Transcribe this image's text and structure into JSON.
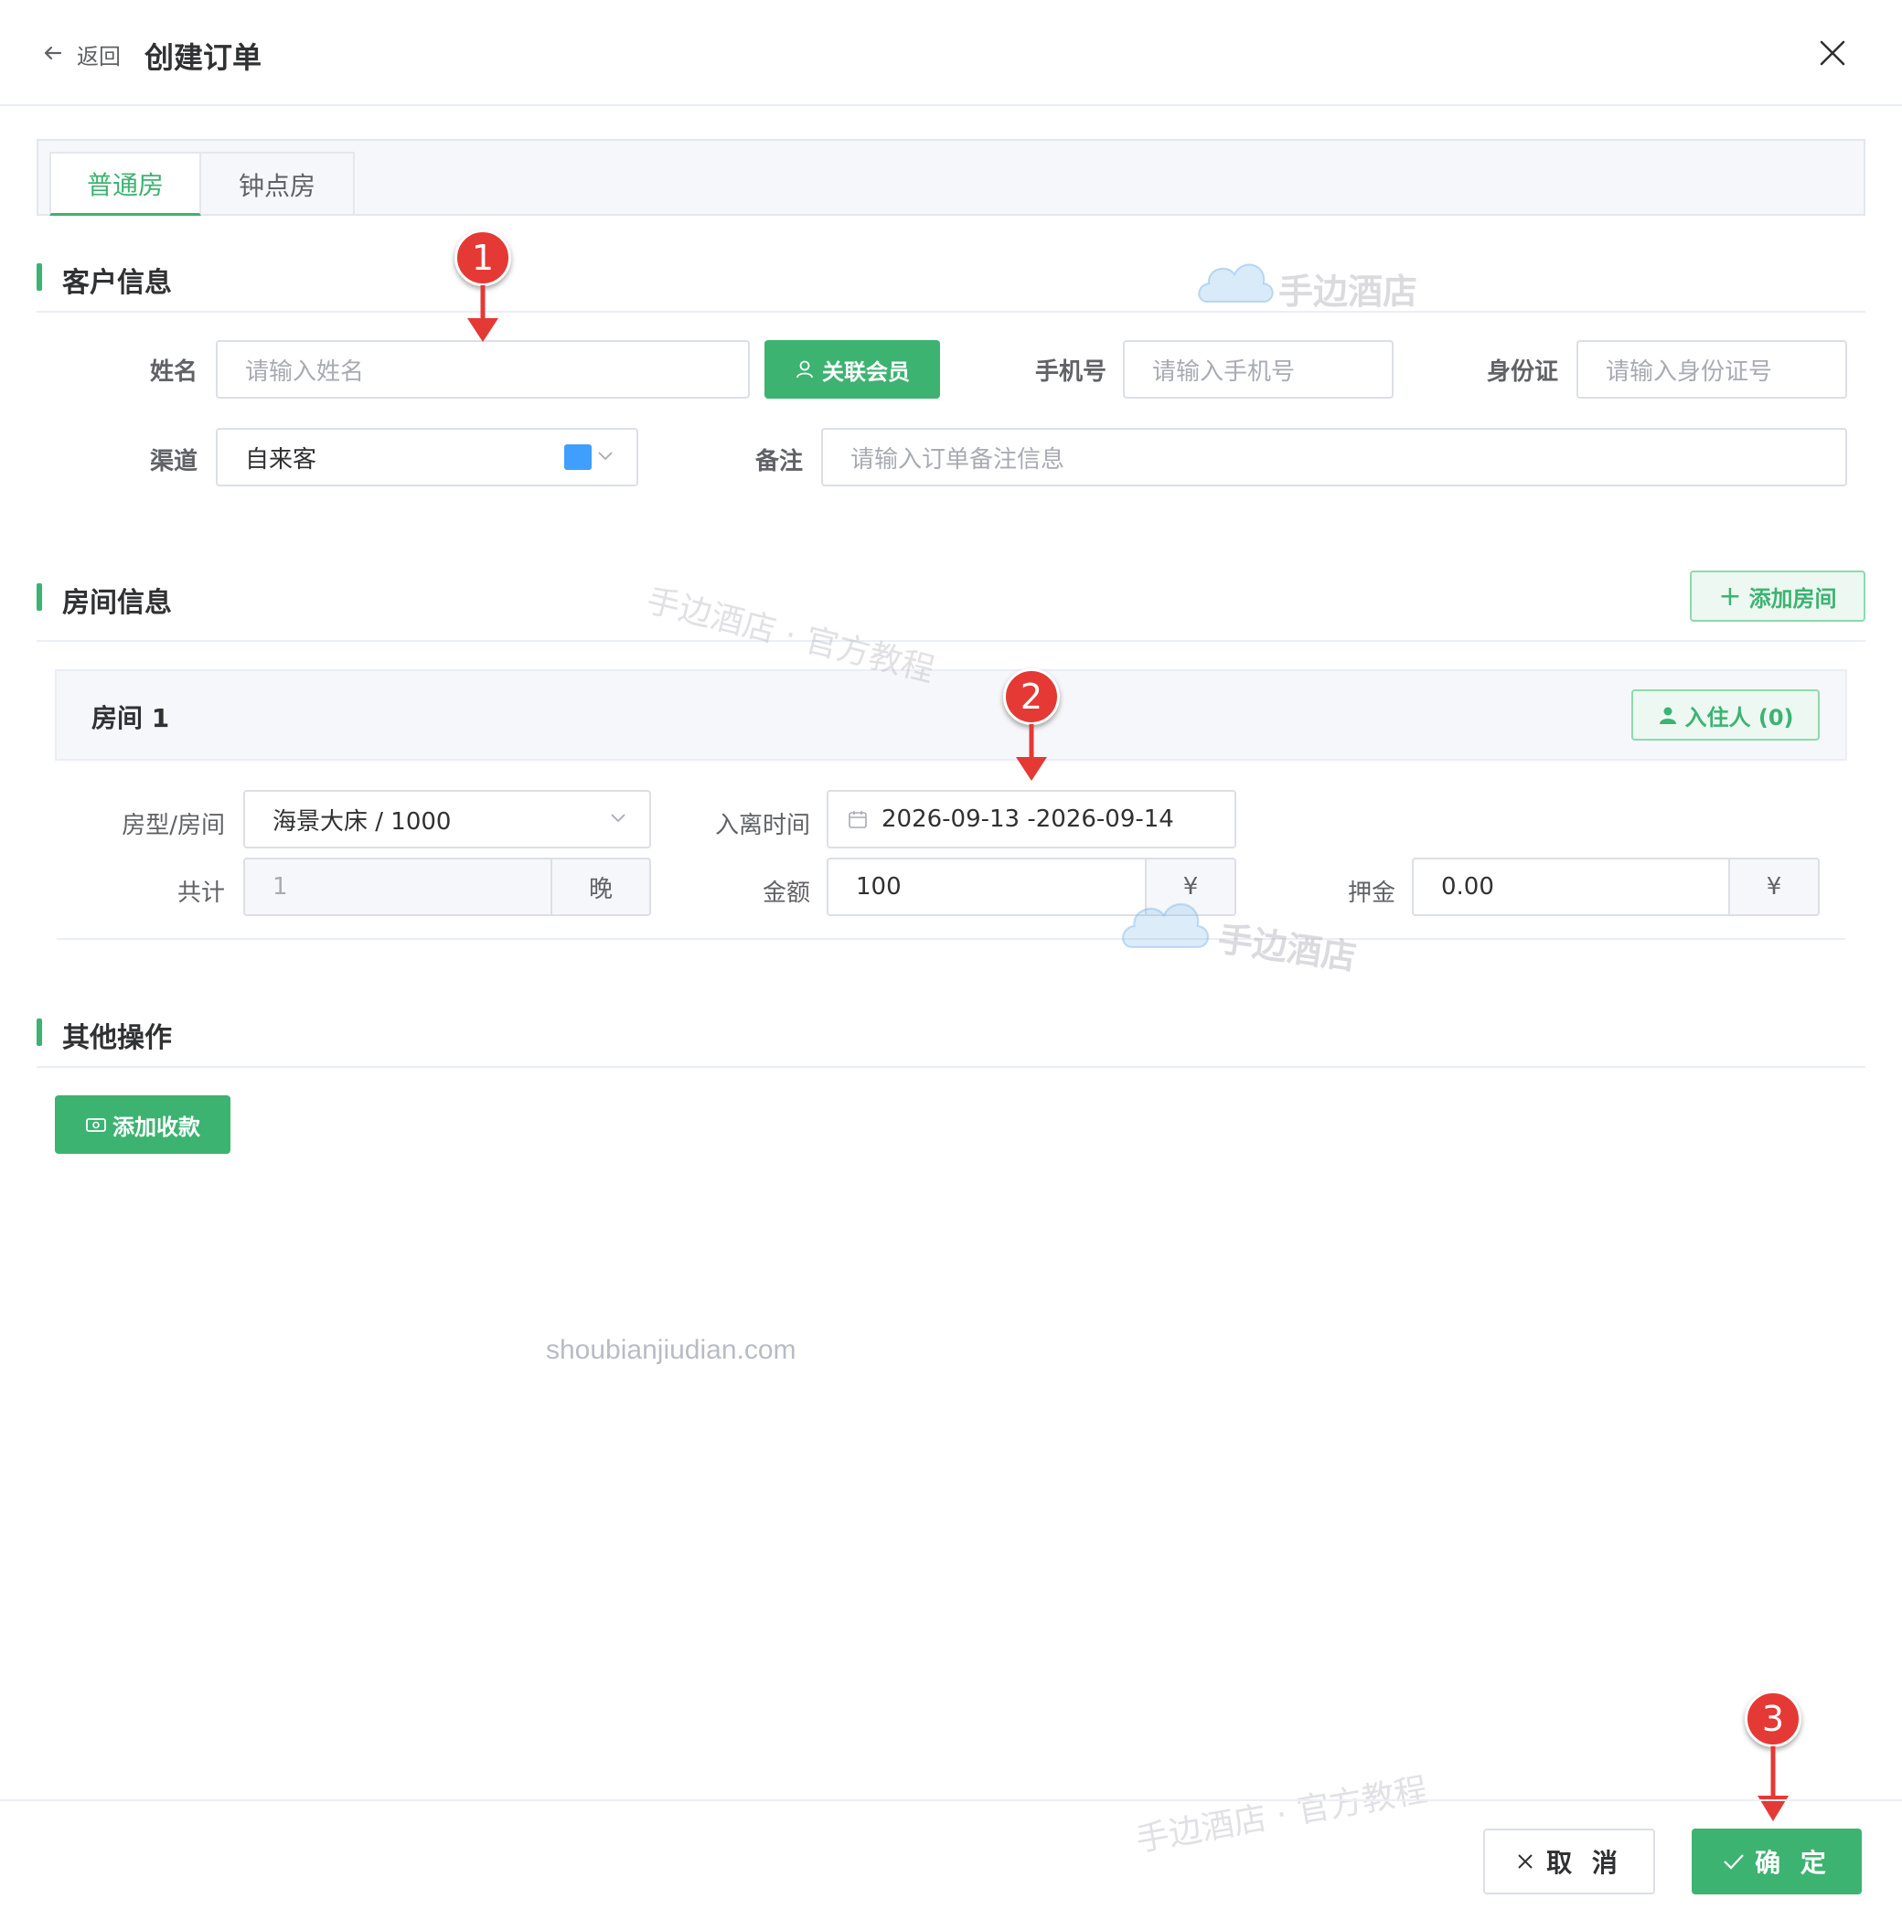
{
  "header": {
    "back_label": "返回",
    "title": "创建订单"
  },
  "tabs": [
    {
      "label": "普通房",
      "active": true
    },
    {
      "label": "钟点房",
      "active": false
    }
  ],
  "customer": {
    "section_title": "客户信息",
    "name_label": "姓名",
    "name_placeholder": "请输入姓名",
    "link_member_label": "关联会员",
    "phone_label": "手机号",
    "phone_placeholder": "请输入手机号",
    "id_label": "身份证",
    "id_placeholder": "请输入身份证号",
    "channel_label": "渠道",
    "channel_value": "自来客",
    "channel_color": "#409eff",
    "remark_label": "备注",
    "remark_placeholder": "请输入订单备注信息"
  },
  "room": {
    "section_title": "房间信息",
    "add_room_label": "添加房间",
    "card_title": "房间 1",
    "guests_label": "入住人 (0)",
    "type_label": "房型/房间",
    "type_value": "海景大床 / 1000",
    "time_label": "入离时间",
    "time_value": "2026-09-13 -2026-09-14",
    "total_label": "共计",
    "total_value": "1",
    "total_unit": "晚",
    "amount_label": "金额",
    "amount_value": "100",
    "amount_unit": "¥",
    "deposit_label": "押金",
    "deposit_value": "0.00",
    "deposit_unit": "¥"
  },
  "other": {
    "section_title": "其他操作",
    "add_payment_label": "添加收款"
  },
  "footer": {
    "cancel_label": "取 消",
    "confirm_label": "确 定"
  },
  "annotations": [
    "1",
    "2",
    "3"
  ],
  "watermarks": {
    "brand": "手边酒店",
    "brand_tutorial": "手边酒店 · 官方教程",
    "site": "shoubianjiudian.com"
  },
  "colors": {
    "accent": "#3cb371",
    "badge": "#e53935"
  }
}
